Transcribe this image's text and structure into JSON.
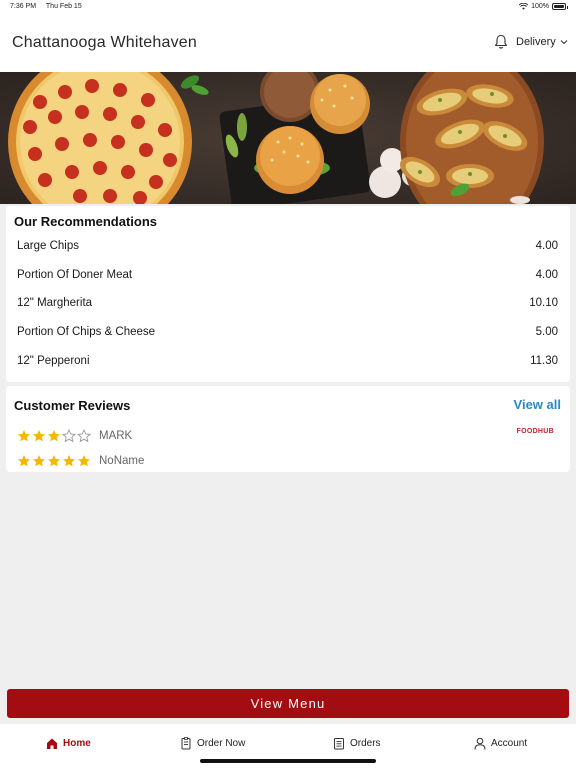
{
  "status_bar": {
    "time": "7:36 PM",
    "date": "Thu Feb 15",
    "battery": "100%"
  },
  "header": {
    "title": "Chattanooga Whitehaven",
    "delivery_label": "Delivery"
  },
  "recommendations": {
    "title": "Our Recommendations",
    "items": [
      {
        "name": "Large Chips",
        "price": "4.00"
      },
      {
        "name": "Portion Of Doner Meat",
        "price": "4.00"
      },
      {
        "name": "12\" Margherita",
        "price": "10.10"
      },
      {
        "name": "Portion Of Chips & Cheese",
        "price": "5.00"
      },
      {
        "name": "12\" Pepperoni",
        "price": "11.30"
      }
    ]
  },
  "reviews": {
    "title": "Customer Reviews",
    "view_all_label": "View all",
    "badge": "FOODHUB",
    "items": [
      {
        "name": "MARK",
        "rating": 3
      },
      {
        "name": "NoName",
        "rating": 5
      }
    ]
  },
  "view_menu_label": "View Menu",
  "tabs": [
    {
      "label": "Home",
      "icon": "home-icon",
      "active": true
    },
    {
      "label": "Order Now",
      "icon": "order-icon",
      "active": false
    },
    {
      "label": "Orders",
      "icon": "orders-list-icon",
      "active": false
    },
    {
      "label": "Account",
      "icon": "account-icon",
      "active": false
    }
  ],
  "colors": {
    "brand": "#a30d12",
    "link": "#2a8ac4",
    "star": "#f5b800"
  }
}
